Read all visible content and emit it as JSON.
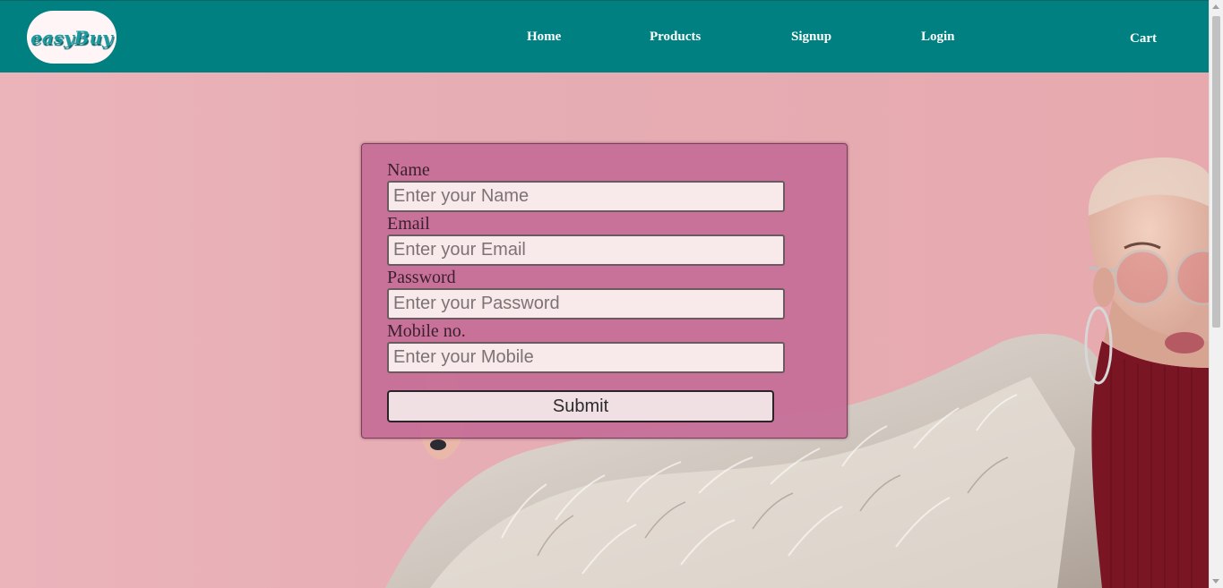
{
  "nav": {
    "logo_text": "easyBuy",
    "links": [
      "Home",
      "Products",
      "Signup",
      "Login"
    ],
    "cart": "Cart"
  },
  "form": {
    "name_label": "Name",
    "name_placeholder": "Enter your Name",
    "email_label": "Email",
    "email_placeholder": "Enter your Email",
    "password_label": "Password",
    "password_placeholder": "Enter your Password",
    "mobile_label": "Mobile no.",
    "mobile_placeholder": "Enter your Mobile",
    "submit": "Submit"
  },
  "colors": {
    "navbar": "#008080",
    "background": "#e8b0b6",
    "form_card": "#c66c98",
    "input_bg": "#f8e9eb"
  },
  "hero_image": "woman-in-fur-coat-photo"
}
